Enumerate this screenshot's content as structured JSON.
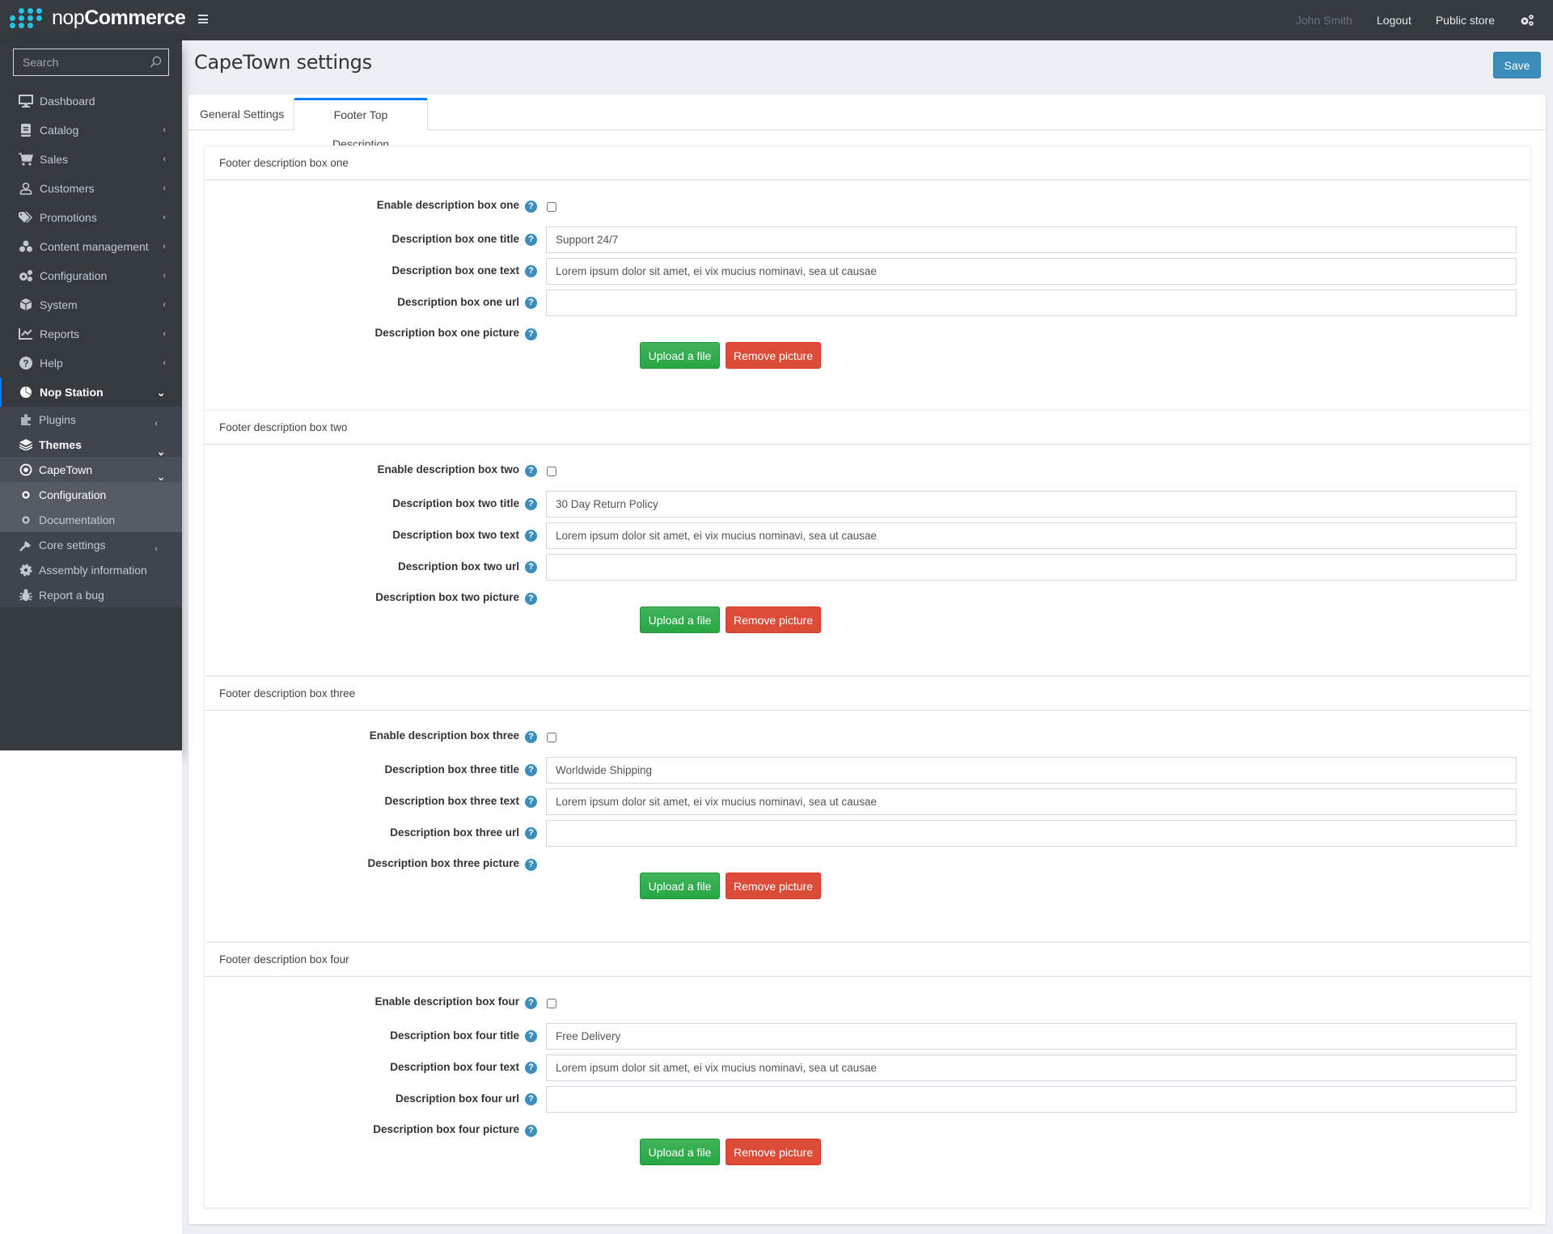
{
  "header": {
    "logo_prefix": "nop",
    "logo_suffix": "Commerce",
    "menu_toggle_icon": "hamburger-icon",
    "user_name": "John Smith",
    "logout": "Logout",
    "public_store": "Public store",
    "settings_icon": "gears-icon"
  },
  "sidebar": {
    "search_placeholder": "Search",
    "items": [
      {
        "label": "Dashboard",
        "icon": "desktop-icon",
        "chevron": ""
      },
      {
        "label": "Catalog",
        "icon": "book-icon",
        "chevron": "‹"
      },
      {
        "label": "Sales",
        "icon": "cart-icon",
        "chevron": "‹"
      },
      {
        "label": "Customers",
        "icon": "user-icon",
        "chevron": "‹"
      },
      {
        "label": "Promotions",
        "icon": "tags-icon",
        "chevron": "‹"
      },
      {
        "label": "Content management",
        "icon": "cubes-icon",
        "chevron": "‹"
      },
      {
        "label": "Configuration",
        "icon": "gears-icon",
        "chevron": "‹"
      },
      {
        "label": "System",
        "icon": "cube-icon",
        "chevron": "‹"
      },
      {
        "label": "Reports",
        "icon": "chart-line-icon",
        "chevron": "‹"
      },
      {
        "label": "Help",
        "icon": "question-circle-icon",
        "chevron": "‹"
      },
      {
        "label": "Nop Station",
        "icon": "pie-chart-icon",
        "chevron": "⌄"
      }
    ],
    "nop_station_children": [
      {
        "label": "Plugins",
        "icon": "puzzle-icon",
        "chevron": "‹"
      },
      {
        "label": "Themes",
        "icon": "layers-icon",
        "chevron": "⌄"
      },
      {
        "label": "CapeTown",
        "icon": "dot-circle-icon",
        "chevron": "⌄"
      }
    ],
    "capetown_children": [
      {
        "label": "Configuration",
        "icon": "circle-icon"
      },
      {
        "label": "Documentation",
        "icon": "circle-icon"
      }
    ],
    "nop_station_more": [
      {
        "label": "Core settings",
        "icon": "wrench-icon",
        "chevron": "‹"
      },
      {
        "label": "Assembly information",
        "icon": "cog-icon",
        "chevron": ""
      },
      {
        "label": "Report a bug",
        "icon": "bug-icon",
        "chevron": ""
      }
    ]
  },
  "page": {
    "title": "CapeTown settings",
    "save": "Save",
    "tabs": [
      {
        "label": "General Settings",
        "active": false
      },
      {
        "label": "Footer Top Description",
        "active": true
      }
    ],
    "help_glyph": "?",
    "upload_label": "Upload a file",
    "remove_label": "Remove picture",
    "boxes": [
      {
        "heading": "Footer description box one",
        "enable_label": "Enable description box one",
        "enabled": false,
        "title_label": "Description box one title",
        "title_value": "Support 24/7",
        "text_label": "Description box one text",
        "text_value": "Lorem ipsum dolor sit amet, ei vix mucius nominavi, sea ut causae",
        "url_label": "Description box one url",
        "url_value": "",
        "picture_label": "Description box one picture"
      },
      {
        "heading": "Footer description box two",
        "enable_label": "Enable description box two",
        "enabled": false,
        "title_label": "Description box two title",
        "title_value": "30 Day Return Policy",
        "text_label": "Description box two text",
        "text_value": "Lorem ipsum dolor sit amet, ei vix mucius nominavi, sea ut causae",
        "url_label": "Description box two url",
        "url_value": "",
        "picture_label": "Description box two picture"
      },
      {
        "heading": "Footer description box three",
        "enable_label": "Enable description box three",
        "enabled": false,
        "title_label": "Description box three title",
        "title_value": "Worldwide Shipping",
        "text_label": "Description box three text",
        "text_value": "Lorem ipsum dolor sit amet, ei vix mucius nominavi, sea ut causae",
        "url_label": "Description box three url",
        "url_value": "",
        "picture_label": "Description box three picture"
      },
      {
        "heading": "Footer description box four",
        "enable_label": "Enable description box four",
        "enabled": false,
        "title_label": "Description box four title",
        "title_value": "Free Delivery",
        "text_label": "Description box four text",
        "text_value": "Lorem ipsum dolor sit amet, ei vix mucius nominavi, sea ut causae",
        "url_label": "Description box four url",
        "url_value": "",
        "picture_label": "Description box four picture"
      }
    ]
  }
}
